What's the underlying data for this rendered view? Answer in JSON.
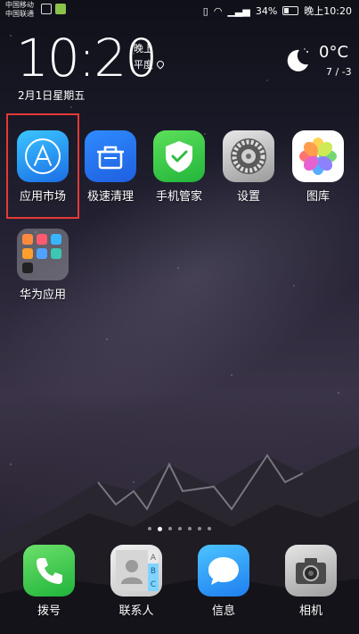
{
  "status_bar": {
    "carrier_1": "中国移动",
    "carrier_2": "中国联通",
    "battery": "34%",
    "time": "晚上10:20"
  },
  "clock_widget": {
    "time": "10:20",
    "period": "晚上",
    "location": "平度",
    "date": "2月1日星期五",
    "temperature": "0°C",
    "range": "7 / -3",
    "weather_icon": "moon-cloud-icon"
  },
  "apps": [
    {
      "label": "应用市场",
      "icon": "app-store-icon"
    },
    {
      "label": "极速清理",
      "icon": "cleaner-icon"
    },
    {
      "label": "手机管家",
      "icon": "shield-check-icon"
    },
    {
      "label": "设置",
      "icon": "gear-icon"
    },
    {
      "label": "图库",
      "icon": "gallery-flower-icon"
    }
  ],
  "folder": {
    "label": "华为应用"
  },
  "dock": [
    {
      "label": "拨号",
      "icon": "phone-icon"
    },
    {
      "label": "联系人",
      "icon": "contacts-icon",
      "tabs": [
        "A",
        "B",
        "C"
      ]
    },
    {
      "label": "信息",
      "icon": "message-icon"
    },
    {
      "label": "相机",
      "icon": "camera-icon"
    }
  ],
  "page_indicator": {
    "count": 7,
    "active": 1
  },
  "colors": {
    "highlight": "#e53935"
  }
}
